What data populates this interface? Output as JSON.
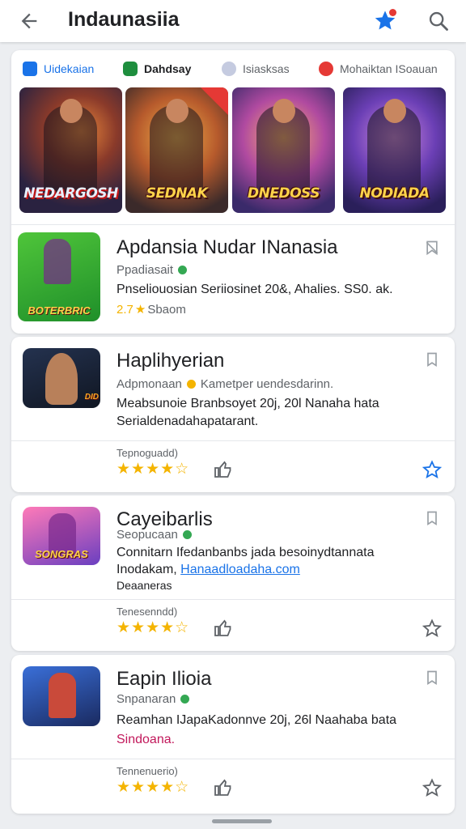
{
  "header": {
    "title": "Indaunasiia",
    "back_icon": "arrow-left-icon",
    "star_icon": "star-icon",
    "search_icon": "search-icon"
  },
  "chips": [
    {
      "label": "Uidekaian",
      "icon": "app-icon"
    },
    {
      "label": "Dahdsay",
      "icon": "games-icon"
    },
    {
      "label": "Isiasksas",
      "icon": "circle-icon"
    },
    {
      "label": "Mohaiktan ISoauan",
      "icon": "alert-icon"
    }
  ],
  "banners": [
    {
      "title": "NEDARGOSH"
    },
    {
      "title": "SEDNAK"
    },
    {
      "title": "DNEDOSS"
    },
    {
      "title": "NODIADA"
    }
  ],
  "featured": {
    "name": "Apdansia Nudar INanasia",
    "developer": "Ppadiasait",
    "description": "Pnseliouosian Seriiosinet 20&, Ahalies. SS0. ak.",
    "rating": "2.7",
    "rating_text": "Sbaom",
    "thumb_text": "BOTERBRIC"
  },
  "apps": [
    {
      "name": "Haplihyerian",
      "developer": "Adpmonaan",
      "subtitle_extra": "Kametper uendesdarinn.",
      "desc_line1": "Meabsunoie Branbsoyet 20j, 20l Nanaha hata",
      "desc_line2": "Serialdenadahapatarant.",
      "ratings_label": "Tepnoguadd)",
      "stars": "★★★★☆",
      "thumb_text": "DID"
    },
    {
      "name": "Cayeibarlis",
      "developer": "Seopucaan",
      "desc_line1": "Connitarn Ifedanbanbs jada besoinydtannata",
      "desc_line2_prefix": "Inodakam,",
      "desc_line2_link": "Hanaadloadaha.com",
      "desc_line3": "Deaaneras",
      "ratings_label": "Tenesenndd)",
      "stars": "★★★★☆",
      "thumb_text": "SONGRAS"
    },
    {
      "name": "Eapin Ilioia",
      "developer": "Snpanaran",
      "desc_line1": "Reamhan IJapaKadonnve 20j, 26l Naahaba bata",
      "desc_line2": "Sindoana.",
      "ratings_label": "Tennenuerio)",
      "stars": "★★★★☆",
      "thumb_text": ""
    }
  ],
  "colors": {
    "accent": "#1a73e8",
    "star": "#f4b400",
    "verified": "#34a853"
  }
}
